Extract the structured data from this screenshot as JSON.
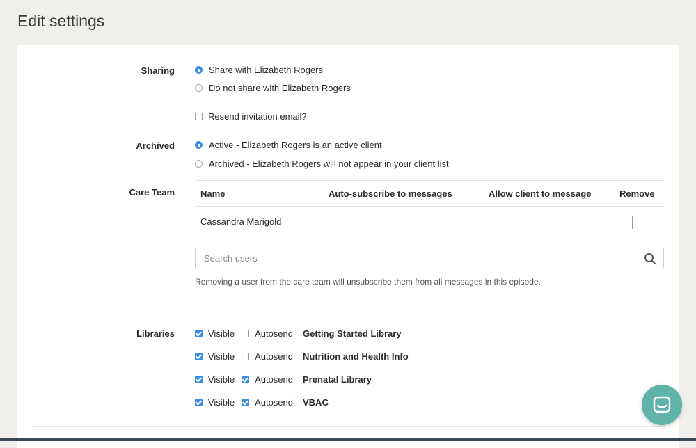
{
  "page": {
    "title": "Edit settings"
  },
  "sharing": {
    "label": "Sharing",
    "options": [
      {
        "label": "Share with Elizabeth Rogers",
        "selected": true
      },
      {
        "label": "Do not share with Elizabeth Rogers",
        "selected": false
      }
    ],
    "resend": {
      "label": "Resend invitation email?",
      "checked": false
    }
  },
  "archived": {
    "label": "Archived",
    "options": [
      {
        "label": "Active - Elizabeth Rogers is an active client",
        "selected": true
      },
      {
        "label": "Archived - Elizabeth Rogers will not appear in your client list",
        "selected": false
      }
    ]
  },
  "care_team": {
    "label": "Care Team",
    "columns": [
      "Name",
      "Auto-subscribe to messages",
      "Allow client to message",
      "Remove"
    ],
    "rows": [
      {
        "name": "Cassandra Marigold",
        "auto_subscribe": true,
        "allow_message": true,
        "remove": false
      }
    ],
    "search_placeholder": "Search users",
    "note": "Removing a user from the care team will unsubscribe them from all messages in this episode."
  },
  "libraries": {
    "label": "Libraries",
    "visible_label": "Visible",
    "autosend_label": "Autosend",
    "items": [
      {
        "name": "Getting Started Library",
        "visible": true,
        "autosend": false
      },
      {
        "name": "Nutrition and Health Info",
        "visible": true,
        "autosend": false
      },
      {
        "name": "Prenatal Library",
        "visible": true,
        "autosend": true
      },
      {
        "name": "VBAC",
        "visible": true,
        "autosend": true
      }
    ]
  },
  "colors": {
    "accent": "#3b8ee6",
    "chat": "#5fb3a8",
    "background": "#f1efeb"
  },
  "icons": {
    "search": "search-icon",
    "chat": "chat-icon"
  }
}
